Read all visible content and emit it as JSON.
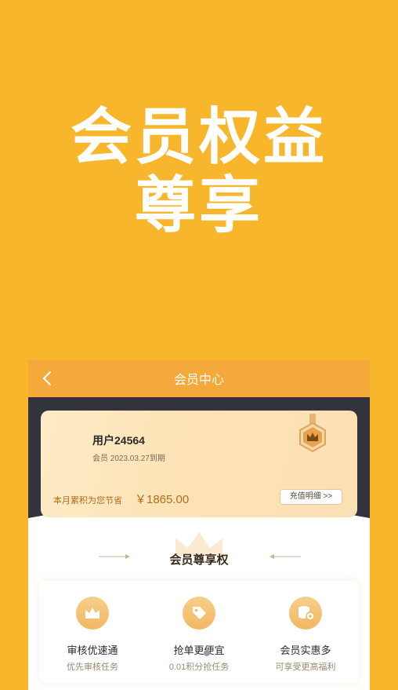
{
  "hero": {
    "line1": "会员权益",
    "line2": "尊享"
  },
  "navbar": {
    "title": "会员中心",
    "back_icon": "chevron-left-icon"
  },
  "card": {
    "username": "用户24564",
    "expiry": "会员  2023.03.27到期",
    "savings_label": "本月累积为您节省",
    "savings_value": "￥1865.00",
    "recharge_label": "充值明细 >>",
    "badge_icon": "crown-badge-icon"
  },
  "section": {
    "title": "会员尊享权"
  },
  "benefits": [
    {
      "name": "审核优速通",
      "desc": "优先审核任务",
      "icon": "crown-icon"
    },
    {
      "name": "抢单更便宜",
      "desc": "0.01积分抢任务",
      "icon": "tag-icon"
    },
    {
      "name": "会员实惠多",
      "desc": "可享受更高福利",
      "icon": "coins-icon"
    }
  ],
  "colors": {
    "background": "#F8B62D",
    "navbar": "#F6A93B",
    "dark_band": "#33333d",
    "accent_text": "#b76b14"
  }
}
